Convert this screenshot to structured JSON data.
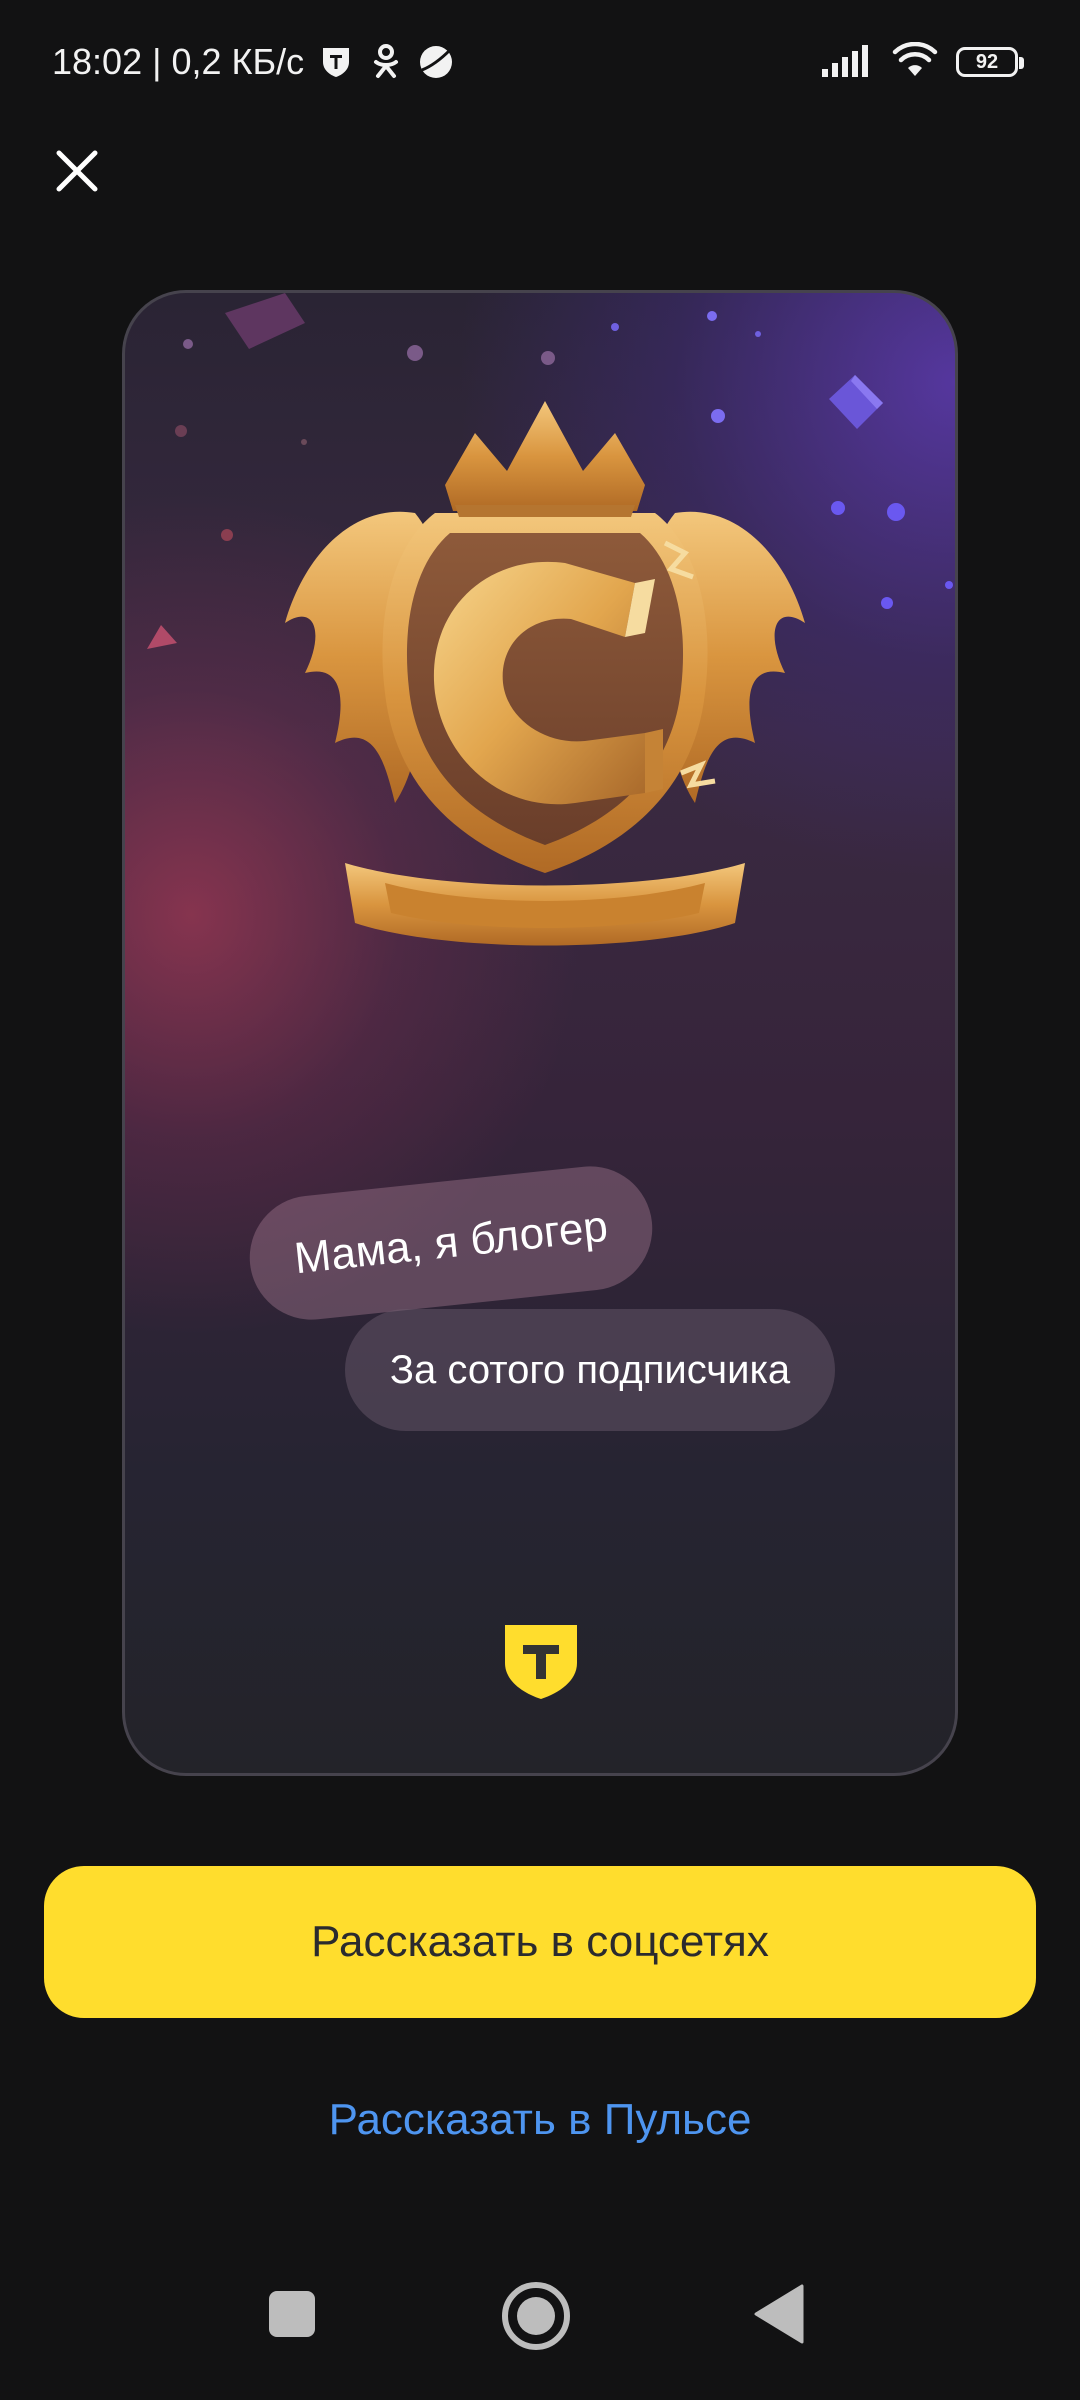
{
  "status_bar": {
    "time": "18:02",
    "separator": "|",
    "network_speed": "0,2 КБ/с",
    "icons": [
      "shield-icon",
      "odnoklassniki-icon",
      "planet-icon",
      "signal-icon",
      "wifi-icon",
      "battery-icon"
    ],
    "battery_level": "92"
  },
  "toolbar": {
    "close_icon": "close-icon"
  },
  "card": {
    "badge_icon": "golden-magnet-emblem",
    "title_chip": "Мама, я блогер",
    "subtitle_chip": "За сотого подписчика",
    "brand_icon": "tbank-shield-logo",
    "colors": {
      "accent_red": "#a03854",
      "accent_purple": "#5c3ab0",
      "gold": "#e2a64e"
    }
  },
  "actions": {
    "share_social_label": "Рассказать в соцсетях",
    "share_pulse_label": "Рассказать в Пульсе",
    "primary_color": "#ffdd2d",
    "link_color": "#4e95f0"
  },
  "nav_bar": {
    "icons": [
      "recents-square-icon",
      "home-circle-icon",
      "back-triangle-icon"
    ]
  }
}
